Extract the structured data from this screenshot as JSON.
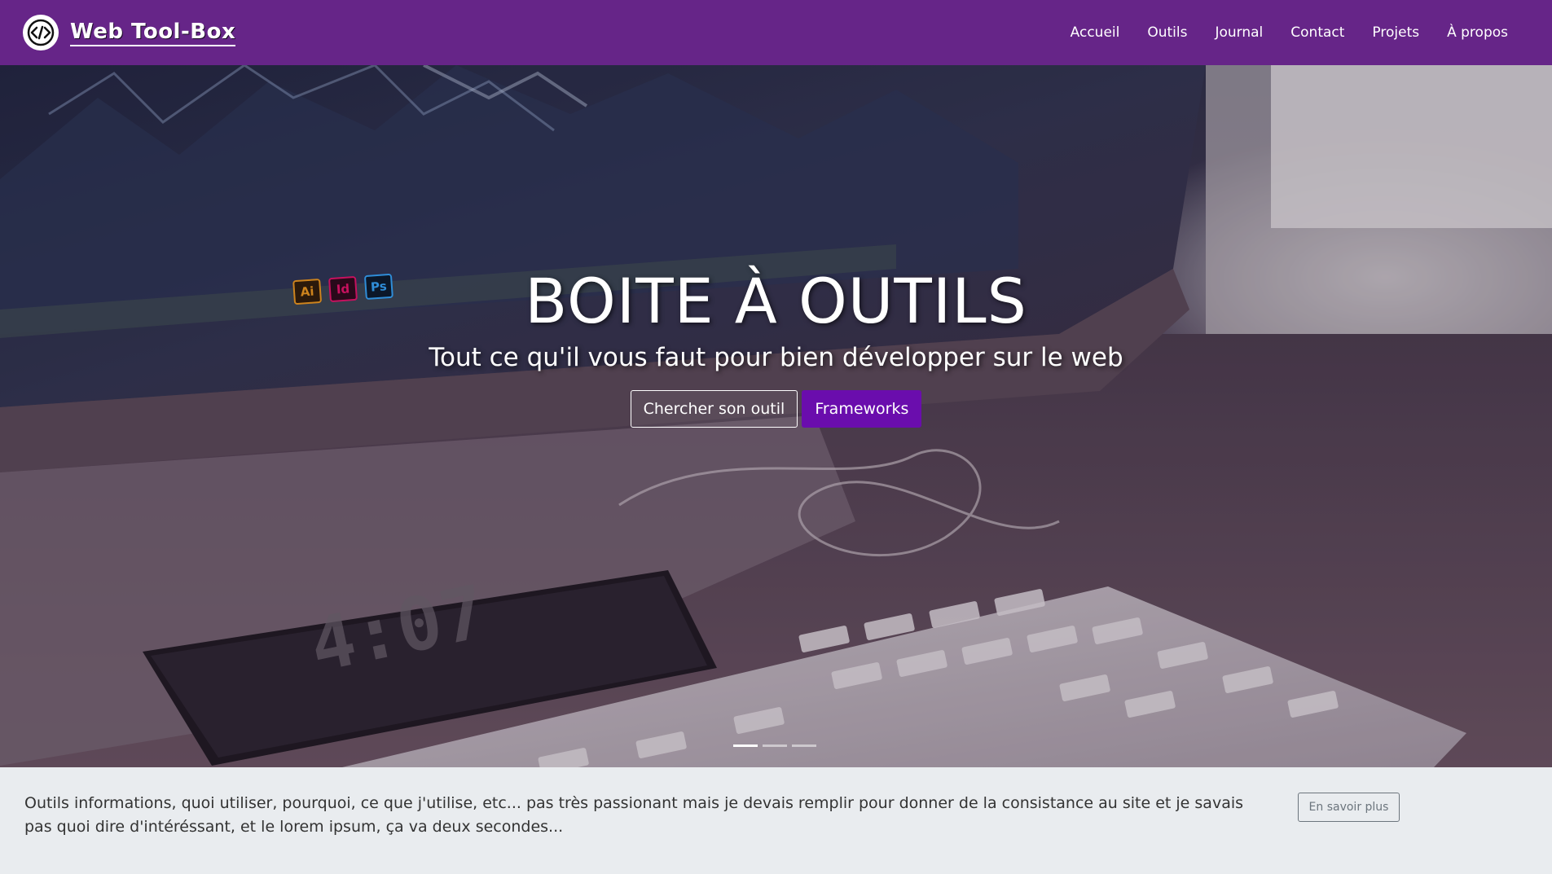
{
  "navbar": {
    "brand": "Web Tool-Box",
    "logo_icon": "code-brackets-icon",
    "background": "#662588",
    "links": [
      "Accueil",
      "Outils",
      "Journal",
      "Contact",
      "Projets",
      "À propos"
    ]
  },
  "hero": {
    "title": "BOITE À OUTILS",
    "subtitle": "Tout ce qu'il vous faut pour bien développer sur le web",
    "primary_button": "Chercher son outil",
    "secondary_button": "Frameworks",
    "secondary_button_color": "#6a0dad",
    "slides_count": 3,
    "active_slide": 1,
    "phone_clock": "4:07",
    "dock_labels": [
      "Ai",
      "Id",
      "Ps"
    ]
  },
  "info": {
    "text": "Outils informations, quoi utiliser, pourquoi, ce que j'utilise, etc... pas très passionant mais je devais remplir pour donner de la consistance au site et je savais pas quoi dire d'intéréssant, et le lorem ipsum, ça va deux secondes...",
    "button": "En savoir plus"
  }
}
